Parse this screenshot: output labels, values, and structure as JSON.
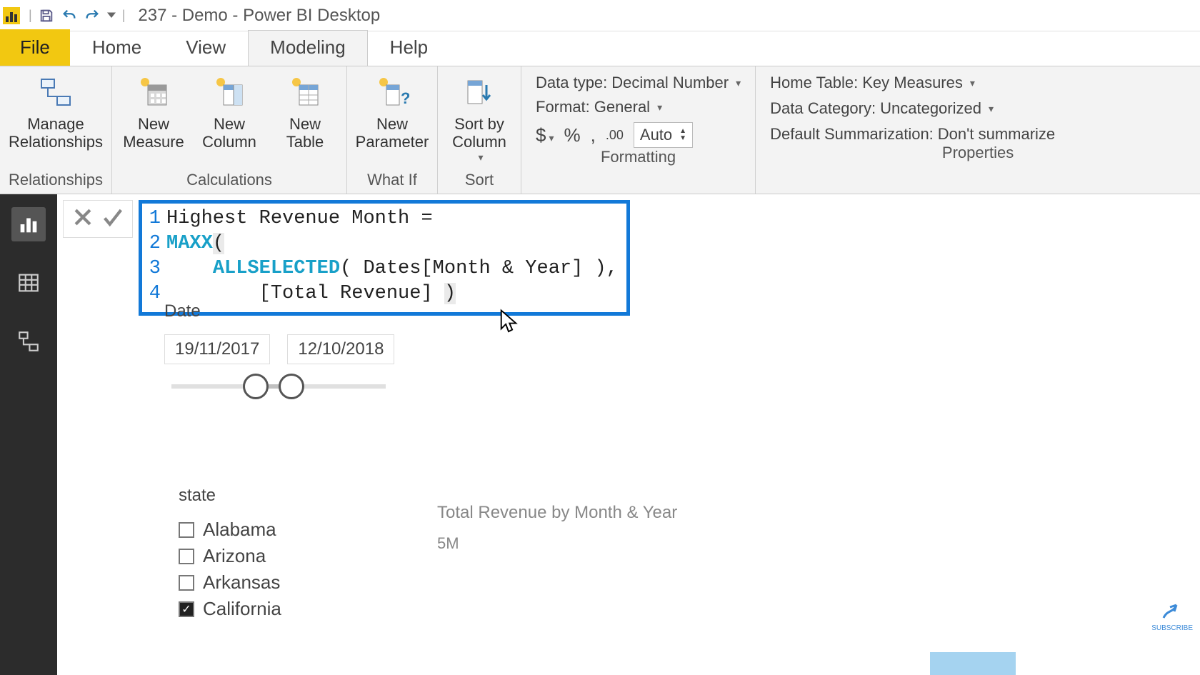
{
  "titlebar": {
    "title": "237 - Demo - Power BI Desktop"
  },
  "tabs": {
    "file": "File",
    "home": "Home",
    "view": "View",
    "modeling": "Modeling",
    "help": "Help"
  },
  "ribbon": {
    "relationships": {
      "label": "Relationships",
      "manage": "Manage\nRelationships"
    },
    "calculations": {
      "label": "Calculations",
      "measure": "New\nMeasure",
      "column": "New\nColumn",
      "table": "New\nTable"
    },
    "whatif": {
      "label": "What If",
      "parameter": "New\nParameter"
    },
    "sort": {
      "label": "Sort",
      "sortby": "Sort by\nColumn"
    },
    "formatting": {
      "label": "Formatting",
      "datatype_lbl": "Data type:",
      "datatype_val": "Decimal Number",
      "format_lbl": "Format:",
      "format_val": "General",
      "decimal": "Auto"
    },
    "properties": {
      "label": "Properties",
      "home_lbl": "Home Table:",
      "home_val": "Key Measures",
      "cat_lbl": "Data Category:",
      "cat_val": "Uncategorized",
      "summ_lbl": "Default Summarization:",
      "summ_val": "Don't summarize"
    }
  },
  "formula": {
    "lines": [
      {
        "n": "1",
        "pre": "",
        "kw": "",
        "post": "Highest Revenue Month ="
      },
      {
        "n": "2",
        "pre": "",
        "kw": "MAXX",
        "post": "("
      },
      {
        "n": "3",
        "pre": "    ",
        "kw": "ALLSELECTED",
        "post": "( Dates[Month & Year] ),"
      },
      {
        "n": "4",
        "pre": "        ",
        "kw": "",
        "post": "[Total Revenue] )"
      }
    ]
  },
  "date_slicer": {
    "title": "Date",
    "from": "19/11/2017",
    "to": "12/10/2018"
  },
  "state_slicer": {
    "title": "state",
    "items": [
      {
        "label": "Alabama",
        "checked": false
      },
      {
        "label": "Arizona",
        "checked": false
      },
      {
        "label": "Arkansas",
        "checked": false
      },
      {
        "label": "California",
        "checked": true
      }
    ]
  },
  "chart": {
    "title": "Total Revenue by Month & Year",
    "ytick": "5M"
  },
  "subscribe": "SUBSCRIBE"
}
